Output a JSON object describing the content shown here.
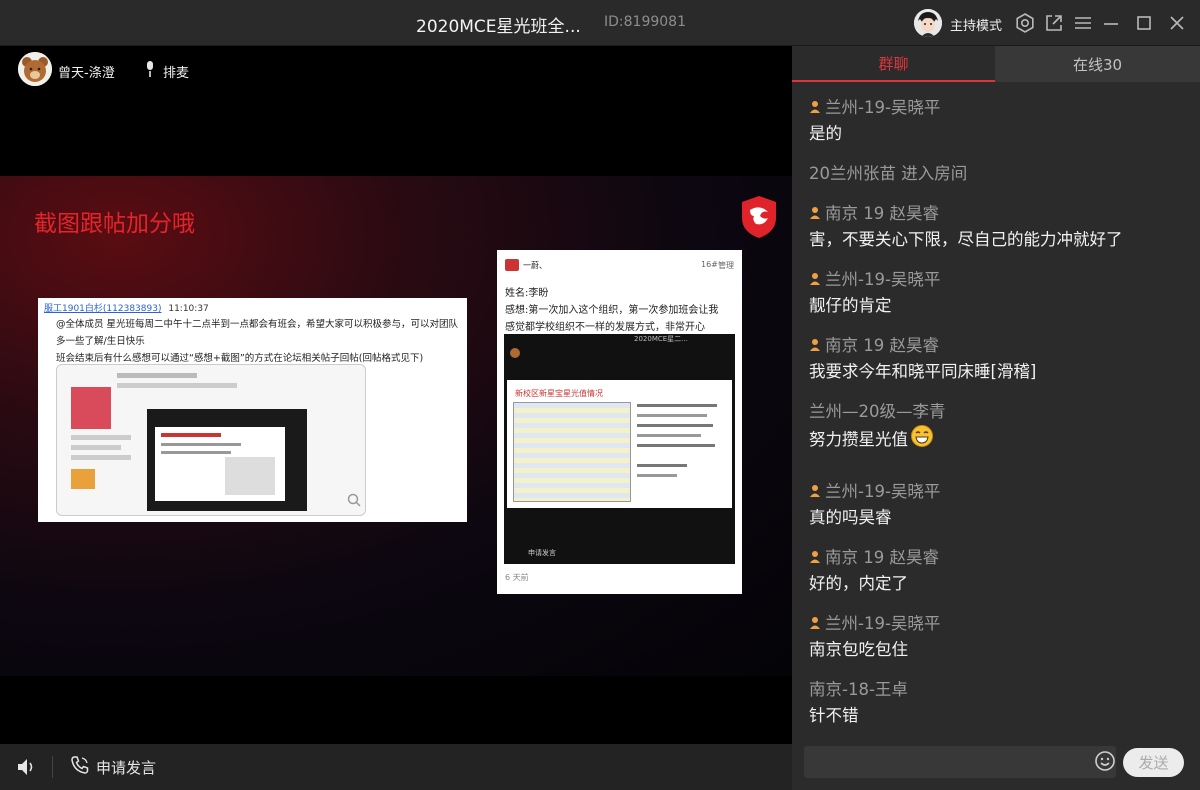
{
  "window": {
    "title": "2020MCE星光班全...",
    "room_id": "ID:8199081",
    "host_label": "主持模式"
  },
  "stage": {
    "speaker_name": "曾天-涤澄",
    "queue_label": "排麦",
    "slide": {
      "title": "截图跟帖加分哦",
      "left_shot": {
        "sender": "服工1901白杉",
        "sender_id": "(112383893)",
        "time": "11:10:37",
        "lines": [
          "@全体成员 星光班每周二中午十二点半到一点都会有班会，希望大家可以积极参与，可以对团队",
          "多一些了解/生日快乐",
          "班会结束后有什么感想可以通过“感想+截图”的方式在论坛相关帖子回帖(回帖格式见下)"
        ]
      },
      "right_shot": {
        "header_user": "一蔚、",
        "header_floor": "16#",
        "header_manage": "管理",
        "name_line": "姓名:李盼",
        "thought_line1": "感想:第一次加入这个组织，第一次参加班会让我",
        "thought_line2": "感觉都学校组织不一样的发展方式，非常开心",
        "inner_room": "2020MCE星二...",
        "inner_slide_title": "新校区新星宝星光值情况",
        "inner_apply": "申请发言",
        "time_ago": "6 天前"
      }
    }
  },
  "bottombar": {
    "apply_label": "申请发言"
  },
  "chat": {
    "tabs": [
      {
        "label": "群聊",
        "active": true
      },
      {
        "label": "在线30",
        "active": false
      }
    ],
    "messages": [
      {
        "type": "user",
        "name": "兰州-19-吴晓平",
        "badge": true,
        "text": "是的"
      },
      {
        "type": "system",
        "text": "20兰州张苗 进入房间"
      },
      {
        "type": "user",
        "name": "南京 19 赵昊睿",
        "badge": true,
        "text": "害，不要关心下限，尽自己的能力冲就好了"
      },
      {
        "type": "user",
        "name": "兰州-19-吴晓平",
        "badge": true,
        "text": "靓仔的肯定"
      },
      {
        "type": "user",
        "name": "南京 19 赵昊睿",
        "badge": true,
        "text": "我要求今年和晓平同床睡[滑稽]"
      },
      {
        "type": "user",
        "name": "兰州—20级—李青",
        "badge": false,
        "text": "努力攒星光值",
        "emoji": "grin-emoji"
      },
      {
        "type": "user",
        "name": "兰州-19-吴晓平",
        "badge": true,
        "text": "真的吗昊睿"
      },
      {
        "type": "user",
        "name": "南京 19 赵昊睿",
        "badge": true,
        "text": "好的，内定了"
      },
      {
        "type": "user",
        "name": "兰州-19-吴晓平",
        "badge": true,
        "text": "南京包吃包住"
      },
      {
        "type": "user",
        "name": "南京-18-王卓",
        "badge": false,
        "text": "针不错"
      }
    ],
    "input_placeholder": "",
    "send_label": "发送"
  },
  "colors": {
    "accent": "#e0343b",
    "badge": "#f0a040"
  }
}
